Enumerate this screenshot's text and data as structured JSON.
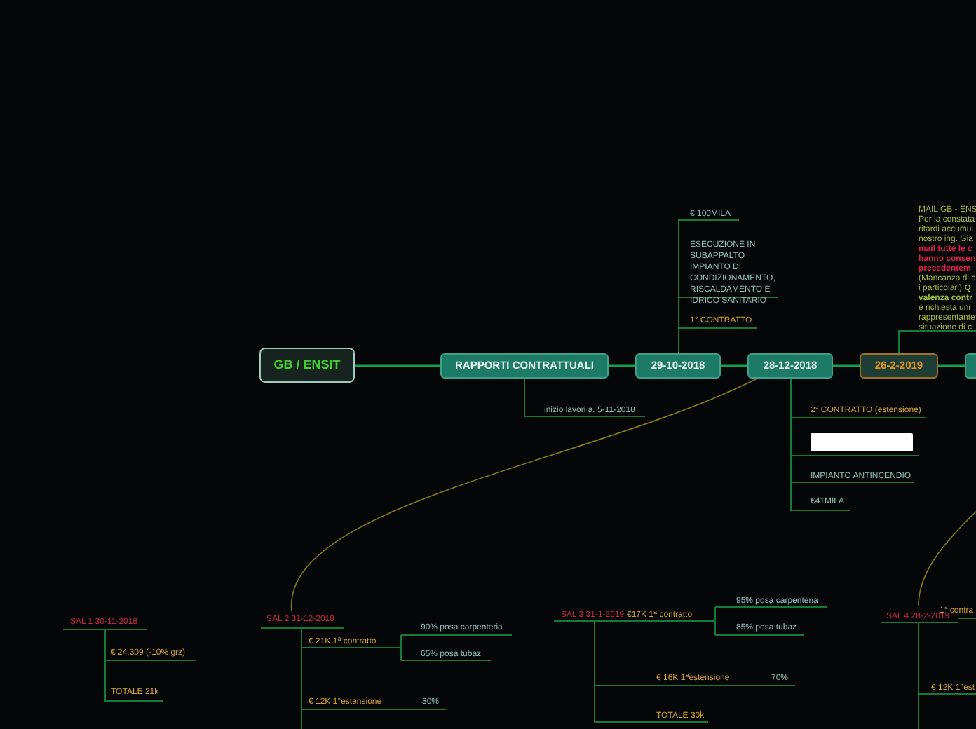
{
  "root": {
    "label": "GB / ENSIT"
  },
  "nodes": [
    {
      "label": "RAPPORTI CONTRATTUALI",
      "kind": "teal"
    },
    {
      "label": "29-10-2018",
      "kind": "teal"
    },
    {
      "label": "28-12-2018",
      "kind": "teal"
    },
    {
      "label": "26-2-2019",
      "kind": "dark"
    },
    {
      "kind": "teal"
    }
  ],
  "notes": [
    {
      "text": "€ 100MILA",
      "kind": "teal"
    },
    {
      "text": "ESECUZIONE IN SUBAPPALTO IMPIANTO DI CONDIZIONAMENTO, RISCALDAMENTO E IDRICO SANITARIO",
      "kind": "teal"
    },
    {
      "text": "1° CONTRATTO",
      "kind": "yellow"
    },
    {
      "text": "inizio lavori a. 5-11-2018",
      "kind": "teal"
    },
    {
      "text": "2° CONTRATTO (estensione)",
      "kind": "yellow"
    },
    {
      "text": "IMPIANTO ANTINCENDIO",
      "kind": "teal"
    },
    {
      "text": "€41MILA",
      "kind": "teal"
    },
    {
      "text": "SAL 1 30-11-2018",
      "kind": "red"
    },
    {
      "text": "€ 24.309 (-10% grz)",
      "kind": "yellow"
    },
    {
      "text": "TOTALE 21k",
      "kind": "yellow"
    },
    {
      "text": "SAL 2 31-12-2018",
      "kind": "red"
    },
    {
      "text": "€ 21K 1$^{a}$ contratto",
      "kind": "yellow"
    },
    {
      "text": "90% posa carpenteria",
      "kind": "teal"
    },
    {
      "text": "65% posa tubaz",
      "kind": "teal"
    },
    {
      "text": "€ 12K 1°estensione",
      "kind": "yellow"
    },
    {
      "text": "30%",
      "kind": "teal"
    },
    {
      "text": "SAL 3 31-1-2019",
      "kind": "red"
    },
    {
      "text": "€17K 1$^{a}$ contratto",
      "kind": "yellow"
    },
    {
      "text": "95% posa carpenteria",
      "kind": "teal"
    },
    {
      "text": "85% posa tubaz",
      "kind": "teal"
    },
    {
      "text": "€ 16K 1$^{a}$estensione",
      "kind": "yellow"
    },
    {
      "text": "70%",
      "kind": "teal"
    },
    {
      "text": "TOTALE 30k",
      "kind": "yellow"
    },
    {
      "text": "SAL 4 28-2-2019",
      "kind": "red"
    },
    {
      "text": "1° contra",
      "kind": "yellow"
    },
    {
      "text": "€ 12K 1°est",
      "kind": "yellow"
    }
  ],
  "mail_note": {
    "lines": [
      {
        "text": "MAIL GB  - ENS",
        "kind": "plain"
      },
      {
        "text": "Per la constata",
        "kind": "plain"
      },
      {
        "text": "ritardi accumul",
        "kind": "plain"
      },
      {
        "text": "nostro ing. Gia",
        "kind": "plain"
      },
      {
        "text": "mail tutte le c",
        "kind": "alert"
      },
      {
        "text": "hanno consen",
        "kind": "alert"
      },
      {
        "text": "precedentem",
        "kind": "alert"
      },
      {
        "text": "(Mancanza di c",
        "kind": "plain"
      },
      {
        "text": "i particolari) **Q**",
        "kind": "plain"
      },
      {
        "text": "valenza contr",
        "kind": "bold"
      },
      {
        "text": "è richiesta uni",
        "kind": "plain"
      },
      {
        "text": "rappresentante",
        "kind": "plain"
      },
      {
        "text": "situazione di c",
        "kind": "plain"
      }
    ]
  }
}
